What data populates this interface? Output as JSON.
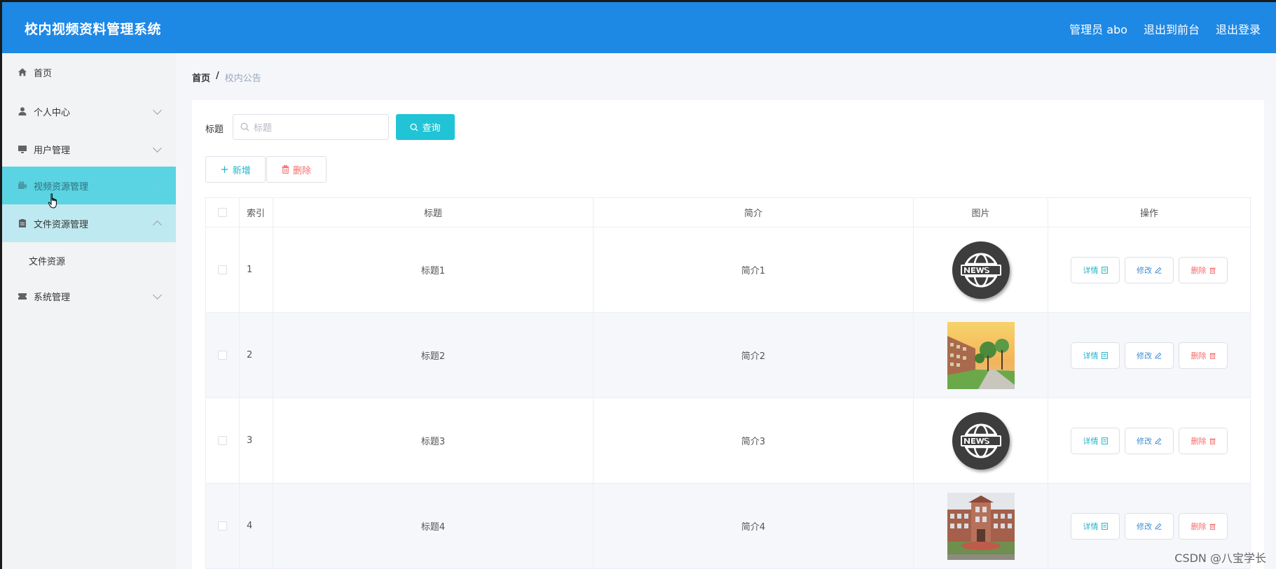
{
  "app": {
    "title": "校内视频资料管理系统",
    "nav": [
      "管理员 abo",
      "退出到前台",
      "退出登录"
    ]
  },
  "sidebar": {
    "items": [
      {
        "label": "首页",
        "icon": "home-icon",
        "has_chevron": false
      },
      {
        "label": "个人中心",
        "icon": "user-icon",
        "has_chevron": true
      },
      {
        "label": "用户管理",
        "icon": "monitor-icon",
        "has_chevron": true
      },
      {
        "label": "视频资源管理",
        "icon": "video-icon",
        "has_chevron": true,
        "state": "hovered"
      },
      {
        "label": "文件资源管理",
        "icon": "clipboard-icon",
        "has_chevron": true,
        "state": "expanded"
      },
      {
        "label": "系统管理",
        "icon": "ticket-icon",
        "has_chevron": true
      }
    ],
    "submenu": [
      "文件资源"
    ]
  },
  "breadcrumb": {
    "home": "首页",
    "separator": "/",
    "current": "校内公告"
  },
  "search": {
    "label": "标题",
    "placeholder": "标题",
    "button": "查询"
  },
  "toolbar": {
    "add": "新增",
    "delete": "删除"
  },
  "table": {
    "columns": [
      "索引",
      "标题",
      "简介",
      "图片",
      "操作"
    ],
    "rows": [
      {
        "index": "1",
        "title": "标题1",
        "desc": "简介1",
        "image": "news-logo"
      },
      {
        "index": "2",
        "title": "标题2",
        "desc": "简介2",
        "image": "campus-road-photo"
      },
      {
        "index": "3",
        "title": "标题3",
        "desc": "简介3",
        "image": "news-logo"
      },
      {
        "index": "4",
        "title": "标题4",
        "desc": "简介4",
        "image": "campus-building-photo"
      }
    ],
    "actions": {
      "detail": "详情",
      "edit": "修改",
      "remove": "删除"
    }
  },
  "watermark": "CSDN @八宝学长",
  "colors": {
    "header": "#1e88e5",
    "sidebar_hover": "#5ad4e2",
    "sidebar_open": "#bfe9f0",
    "primary": "#20c4d6",
    "danger": "#f56c6c",
    "edit": "#3f8fd6"
  }
}
